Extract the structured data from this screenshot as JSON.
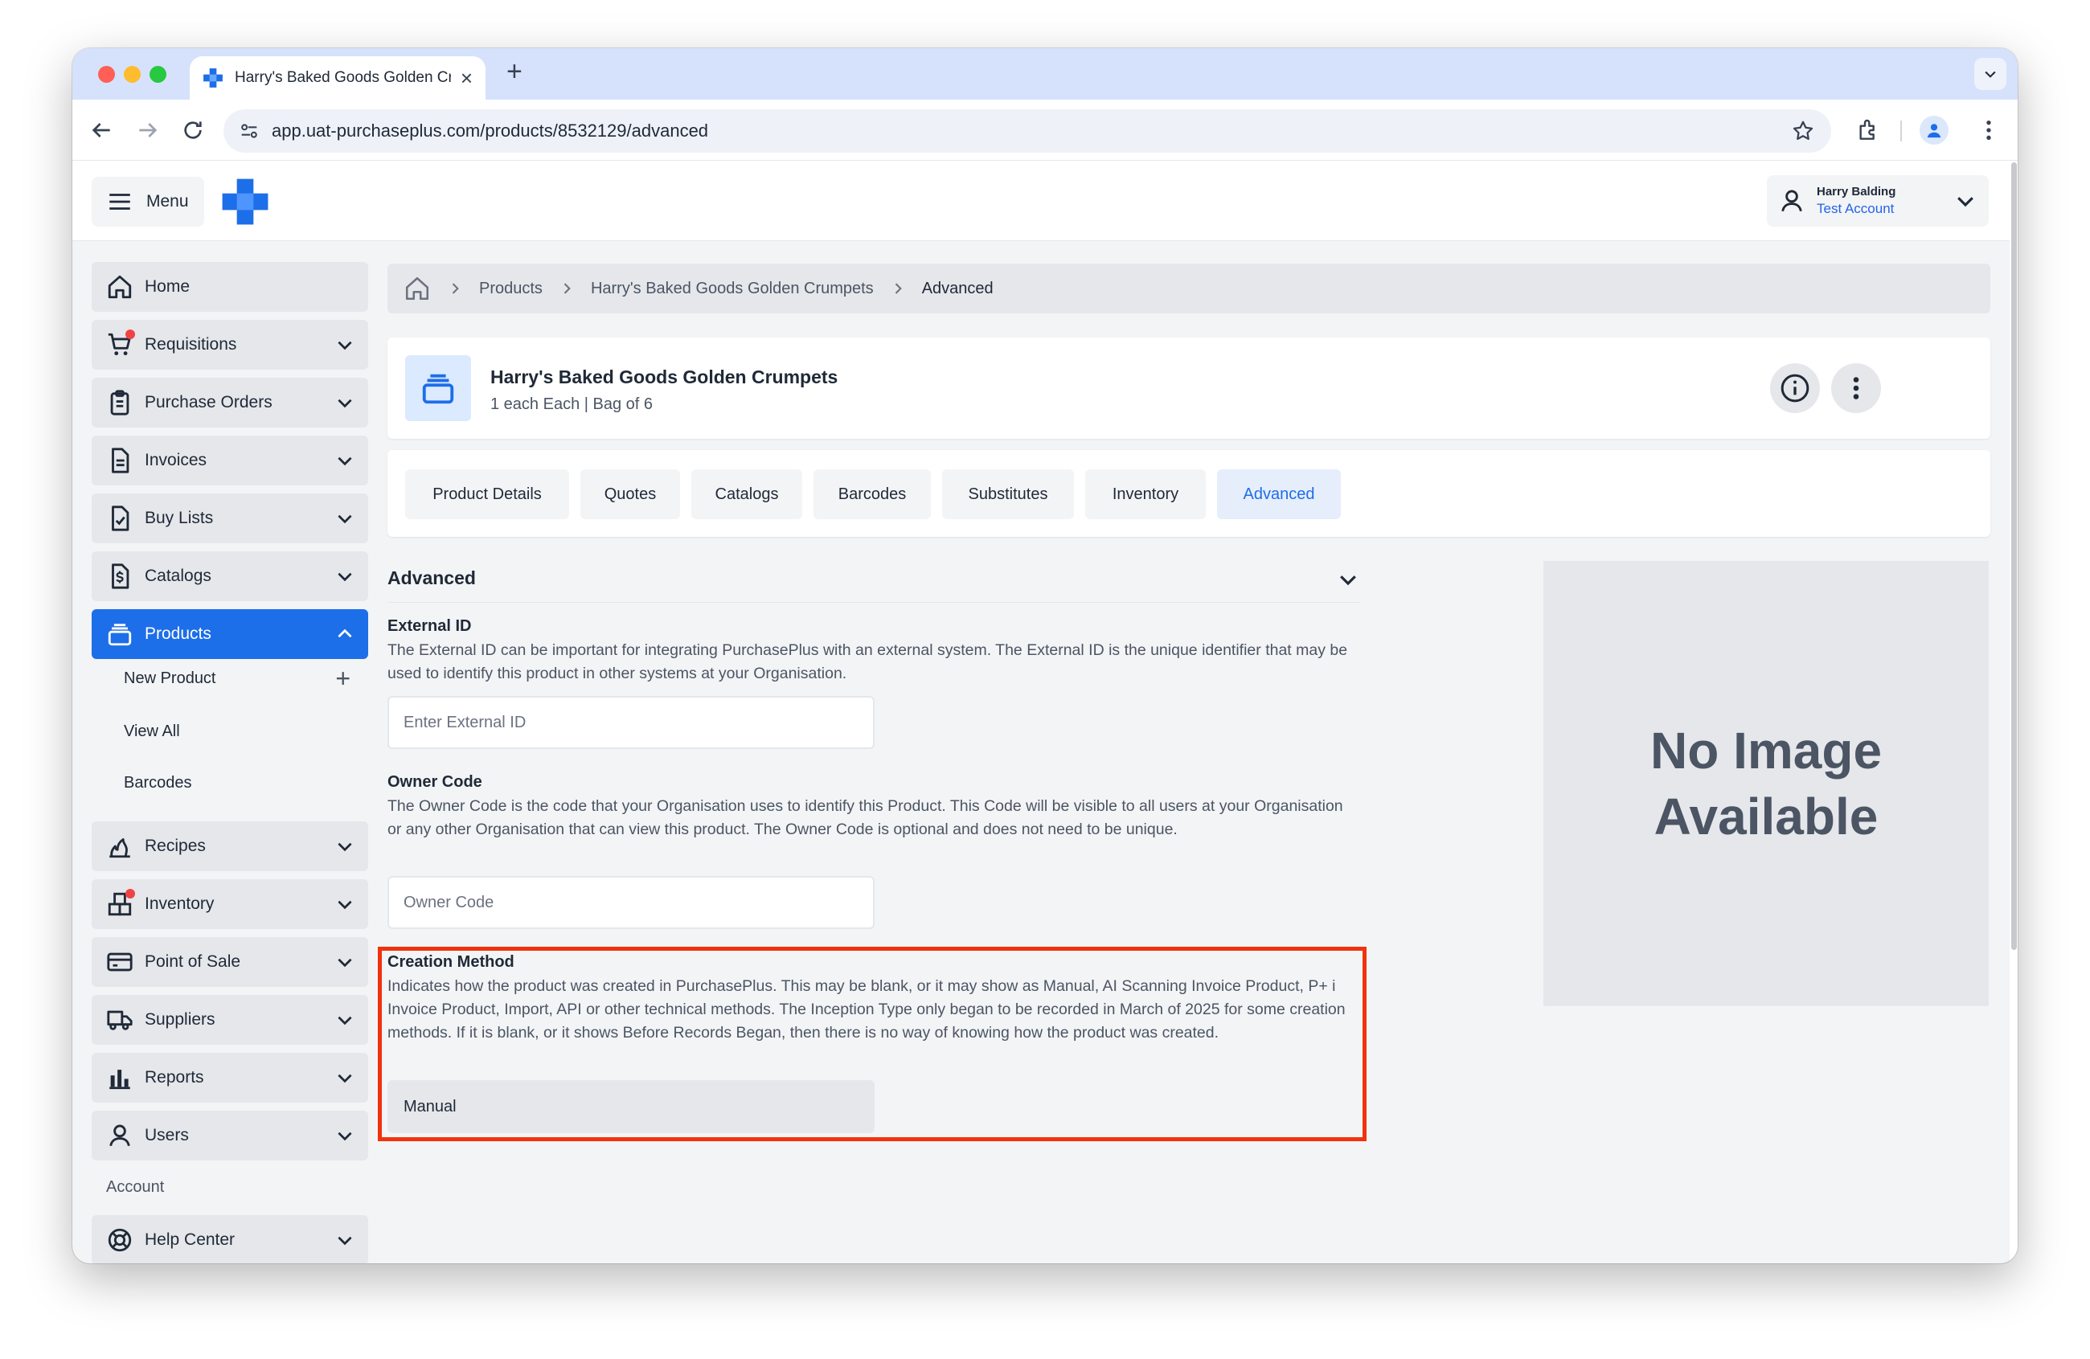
{
  "browser": {
    "tab_title": "Harry's Baked Goods Golden Crumpets",
    "url": "app.uat-purchaseplus.com/products/8532129/advanced"
  },
  "header": {
    "menu_label": "Menu",
    "user_name": "Harry Balding",
    "user_account": "Test Account"
  },
  "sidebar": {
    "items": [
      {
        "label": "Home",
        "icon": "home-icon"
      },
      {
        "label": "Requisitions",
        "icon": "cart-icon"
      },
      {
        "label": "Purchase Orders",
        "icon": "clipboard-icon"
      },
      {
        "label": "Invoices",
        "icon": "document-icon"
      },
      {
        "label": "Buy Lists",
        "icon": "checklist-icon"
      },
      {
        "label": "Catalogs",
        "icon": "dollar-document-icon"
      },
      {
        "label": "Products",
        "icon": "products-icon"
      },
      {
        "label": "Recipes",
        "icon": "flame-icon"
      },
      {
        "label": "Inventory",
        "icon": "blocks-icon"
      },
      {
        "label": "Point of Sale",
        "icon": "credit-card-icon"
      },
      {
        "label": "Suppliers",
        "icon": "truck-icon"
      },
      {
        "label": "Reports",
        "icon": "bar-chart-icon"
      },
      {
        "label": "Users",
        "icon": "user-icon"
      },
      {
        "label": "Help Center",
        "icon": "lifebuoy-icon"
      }
    ],
    "products_subitems": [
      "New Product",
      "View All",
      "Barcodes"
    ],
    "account_heading": "Account"
  },
  "breadcrumb": {
    "items": [
      "Products",
      "Harry's Baked Goods Golden Crumpets"
    ],
    "current": "Advanced"
  },
  "product": {
    "name": "Harry's Baked Goods Golden Crumpets",
    "subtitle": "1 each Each | Bag of 6"
  },
  "tabs": [
    "Product Details",
    "Quotes",
    "Catalogs",
    "Barcodes",
    "Substitutes",
    "Inventory",
    "Advanced"
  ],
  "active_tab": "Advanced",
  "section": {
    "title": "Advanced",
    "external_id": {
      "label": "External ID",
      "description": "The External ID can be important for integrating PurchasePlus with an external system. The External ID is the unique identifier that may be used to identify this product in other systems at your Organisation.",
      "placeholder": "Enter External ID"
    },
    "owner_code": {
      "label": "Owner Code",
      "description": "The Owner Code is the code that your Organisation uses to identify this Product. This Code will be visible to all users at your Organisation or any other Organisation that can view this product. The Owner Code is optional and does not need to be unique.",
      "placeholder": "Owner Code"
    },
    "creation_method": {
      "label": "Creation Method",
      "description": "Indicates how the product was created in PurchasePlus. This may be blank, or it may show as Manual, AI Scanning Invoice Product, P+ i Invoice Product, Import, API or other technical methods. The Inception Type only began to be recorded in March of 2025 for some creation methods. If it is blank, or it shows Before Records Began, then there is no way of knowing how the product was created.",
      "value": "Manual"
    }
  },
  "image_placeholder": "No Image Available",
  "colors": {
    "accent": "#1d6ee9",
    "highlight": "#f0330e",
    "notification": "#ef4444"
  }
}
